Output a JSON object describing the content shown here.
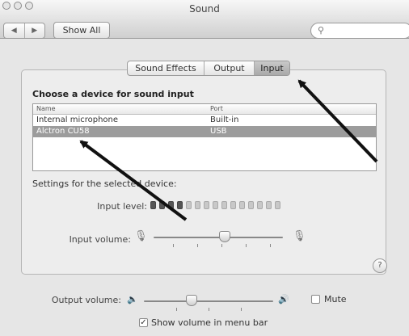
{
  "window": {
    "title": "Sound"
  },
  "toolbar": {
    "back_label": "◀",
    "forward_label": "▶",
    "show_all_label": "Show All",
    "search_icon": "search-icon",
    "search_value": "",
    "search_placeholder": ""
  },
  "tabs": [
    {
      "label": "Sound Effects",
      "selected": false
    },
    {
      "label": "Output",
      "selected": false
    },
    {
      "label": "Input",
      "selected": true
    }
  ],
  "input_pane": {
    "heading": "Choose a device for sound input",
    "columns": [
      "Name",
      "Port"
    ],
    "devices": [
      {
        "name": "Internal microphone",
        "port": "Built-in",
        "selected": false
      },
      {
        "name": "Alctron CU58",
        "port": "USB",
        "selected": true
      }
    ],
    "settings_label": "Settings for the selected device:",
    "input_level_label": "Input level:",
    "input_level_segments": 15,
    "input_level_active": 4,
    "input_volume_label": "Input volume:",
    "input_volume_value": 0.55
  },
  "output": {
    "volume_label": "Output volume:",
    "volume_value": 0.37,
    "mute_label": "Mute",
    "mute_checked": false,
    "show_volume_label": "Show volume in menu bar",
    "show_volume_checked": true
  },
  "colors": {
    "selection": "#9c9c9c",
    "arrow": "#111111"
  }
}
